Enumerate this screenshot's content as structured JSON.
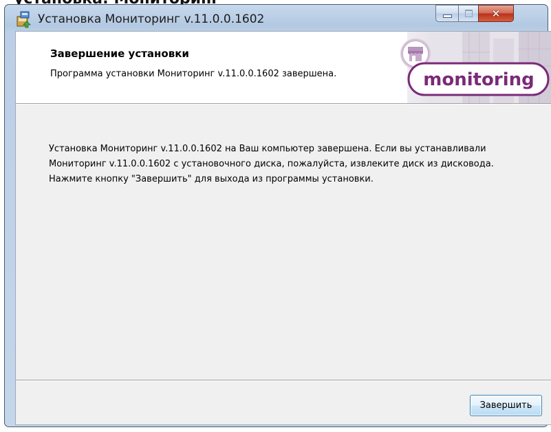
{
  "window": {
    "title": "Установка Мониторинг v.11.0.0.1602",
    "close_glyph": "✕"
  },
  "banner": {
    "title": "Завершение установки",
    "subtitle": "Программа установки Мониторинг v.11.0.0.1602 завершена.",
    "logo_text": "monitoring"
  },
  "body": {
    "message": "Установка Мониторинг v.11.0.0.1602 на Ваш компьютер завершена. Если вы устанавливали Мониторинг v.11.0.0.1602 с установочного диска, пожалуйста, извлеките диск из дисковода. Нажмите кнопку \"Завершить\" для выхода из программы установки."
  },
  "buttons": {
    "finish": "Завершить"
  },
  "icons": {
    "app": "installer-icon",
    "minimize": "minimize-icon",
    "maximize": "maximize-icon",
    "close": "close-icon",
    "logo": "monitoring-logo"
  },
  "colors": {
    "logo_purple": "#7a2a78",
    "close_red": "#c8452c",
    "window_frame": "#b3c9e2"
  }
}
